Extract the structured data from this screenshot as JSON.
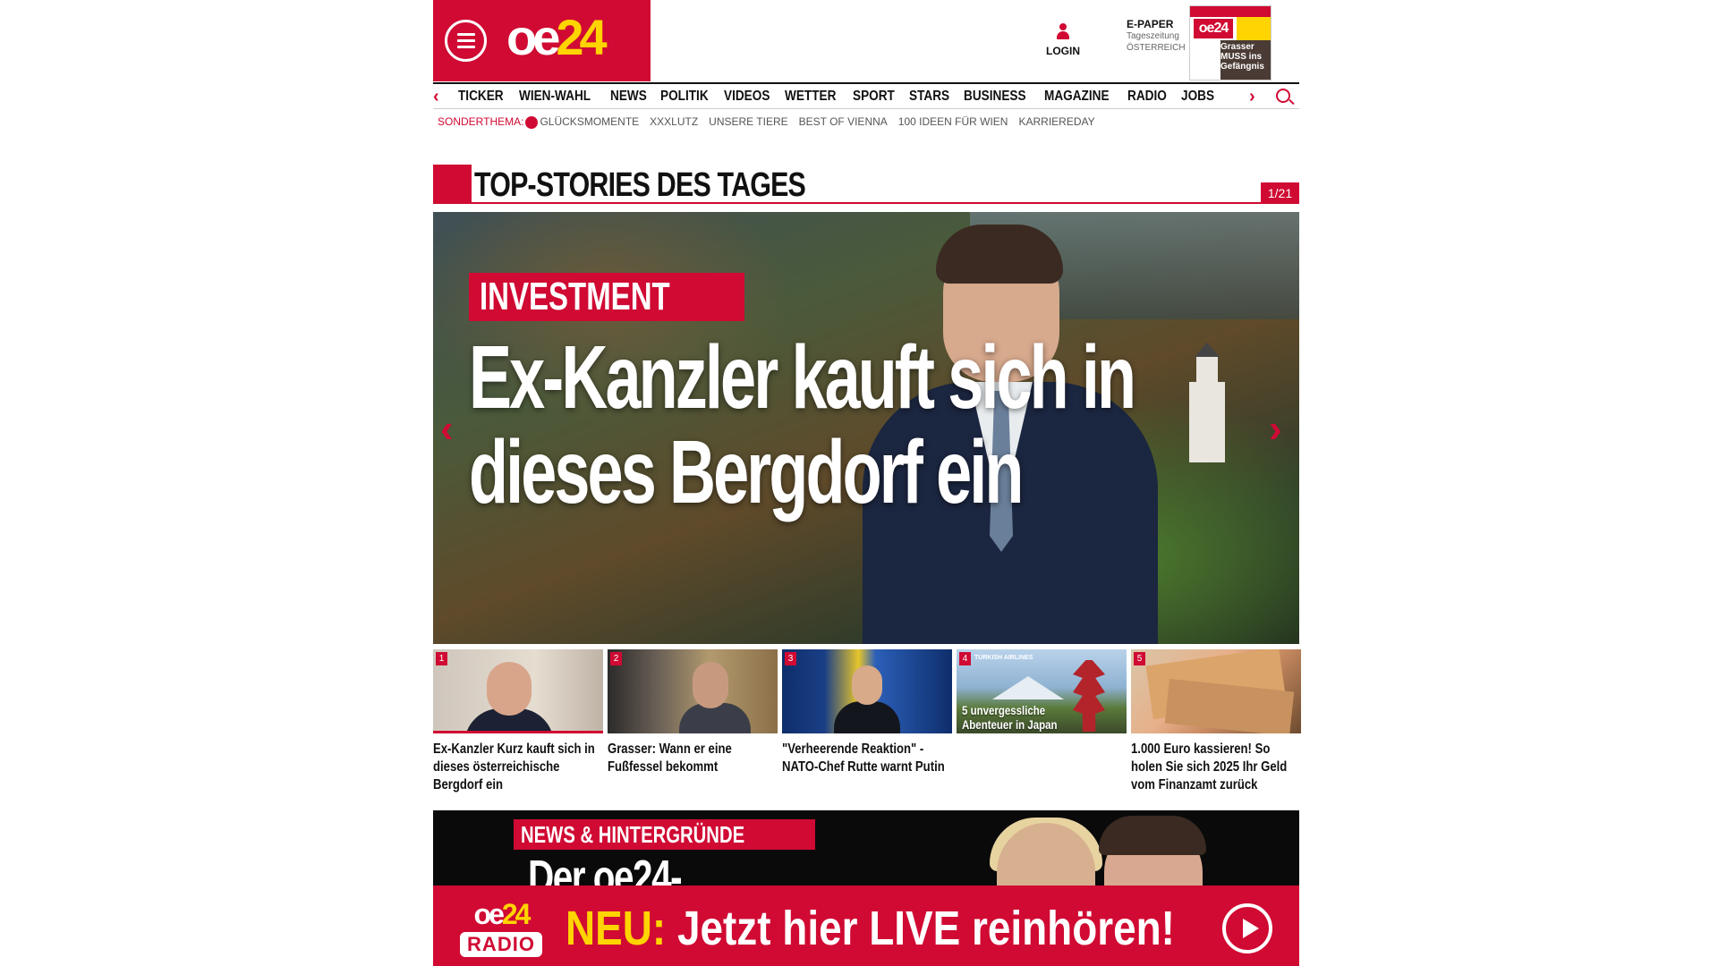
{
  "header": {
    "logo_prefix": "oe",
    "logo_num": "24",
    "login_label": "LOGIN",
    "epaper_title": "E-PAPER",
    "epaper_sub1": "Tageszeitung",
    "epaper_sub2": "ÖSTERREICH",
    "epaper_thumb_logo": "oe24",
    "epaper_thumb_headline": "Grasser MUSS ins Gefängnis"
  },
  "nav": {
    "items": [
      "TICKER",
      "WIEN-WAHL",
      "NEWS",
      "POLITIK",
      "VIDEOS",
      "WETTER",
      "SPORT",
      "STARS",
      "BUSINESS",
      "MAGAZINE",
      "RADIO",
      "JOBS"
    ]
  },
  "subnav": {
    "label": "SONDERTHEMA:",
    "items": [
      "GLÜCKSMOMENTE",
      "XXXLUTZ",
      "UNSERE TIERE",
      "BEST OF VIENNA",
      "100 IDEEN FÜR WIEN",
      "KARRIEREDAY"
    ]
  },
  "section": {
    "title": "TOP-STORIES DES TAGES",
    "pager": "1/21"
  },
  "hero": {
    "tag": "INVESTMENT",
    "headline": "Ex-Kanzler kauft sich in dieses Bergdorf ein"
  },
  "thumbs": [
    {
      "num": "1",
      "caption": "Ex-Kanzler Kurz kauft sich in dieses österreichische Bergdorf ein"
    },
    {
      "num": "2",
      "caption": "Grasser: Wann er eine Fußfessel bekommt"
    },
    {
      "num": "3",
      "caption": "\"Verheerende Reaktion\" - NATO-Chef Rutte warnt Putin"
    },
    {
      "num": "4",
      "caption": "",
      "overlay": "5 unvergessliche Abenteuer in Japan",
      "brand": "TURKISH AIRLINES"
    },
    {
      "num": "5",
      "caption": "1.000 Euro kassieren! So holen Sie sich 2025 Ihr Geld vom Finanzamt zurück"
    }
  ],
  "news": {
    "tag": "NEWS & HINTERGRÜNDE",
    "headline": "Der oe24-"
  },
  "radio": {
    "logo_prefix": "oe",
    "logo_num": "24",
    "logo_sub": "RADIO",
    "new_label": "NEU:",
    "text": "Jetzt hier LIVE reinhören!"
  },
  "colors": {
    "brand_red": "#d00a33",
    "brand_yellow": "#ffd400"
  }
}
